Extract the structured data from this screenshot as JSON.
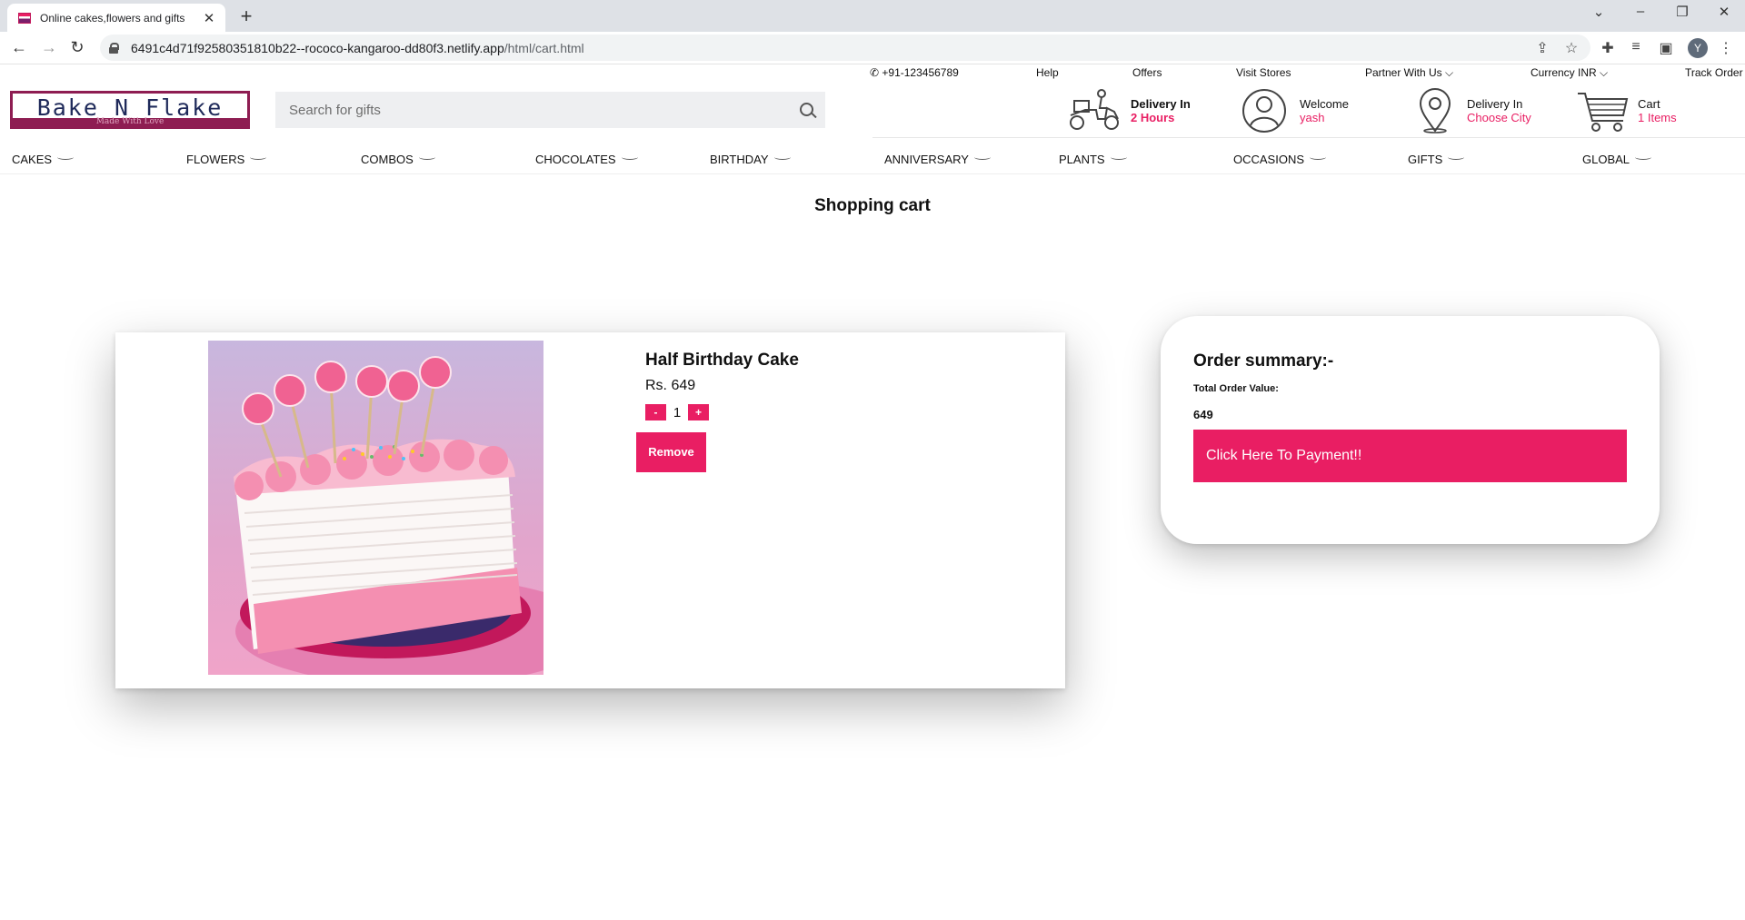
{
  "browser": {
    "tab_title": "Online cakes,flowers and gifts",
    "url_host": "6491c4d71f92580351810b22--rococo-kangaroo-dd80f3.netlify.app",
    "url_path": "/html/cart.html",
    "avatar_letter": "Y"
  },
  "topbar": {
    "phone": "+91-123456789",
    "help": "Help",
    "offers": "Offers",
    "visit_stores": "Visit Stores",
    "partner": "Partner With Us",
    "currency": "Currency INR",
    "track": "Track Order"
  },
  "logo": {
    "title": "Bake N Flake",
    "tagline": "Made With Love"
  },
  "search": {
    "placeholder": "Search for gifts"
  },
  "header": {
    "delivery_time": {
      "line1": "Delivery In",
      "line2": "2 Hours"
    },
    "account": {
      "line1": "Welcome",
      "line2": "yash"
    },
    "location": {
      "line1": "Delivery In",
      "line2": "Choose City"
    },
    "cart": {
      "line1": "Cart",
      "line2": "1 Items"
    }
  },
  "menu": [
    "CAKES",
    "FLOWERS",
    "COMBOS",
    "CHOCOLATES",
    "BIRTHDAY",
    "ANNIVERSARY",
    "PLANTS",
    "OCCASIONS",
    "GIFTS",
    "GLOBAL"
  ],
  "page_title": "Shopping cart",
  "cart_item": {
    "name": "Half Birthday Cake",
    "price": "Rs. 649",
    "qty": "1",
    "minus": "-",
    "plus": "+",
    "remove": "Remove"
  },
  "summary": {
    "title": "Order summary:-",
    "total_label": "Total Order Value:",
    "total_value": "649",
    "pay_button": "Click Here To Payment!!"
  },
  "colors": {
    "accent": "#e91e63",
    "brand": "#8e1d52"
  }
}
